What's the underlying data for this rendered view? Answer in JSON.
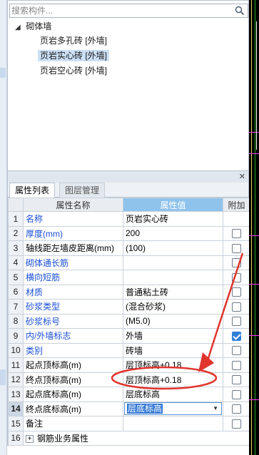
{
  "search": {
    "placeholder": "搜索构件..."
  },
  "tree": {
    "root_label": "砌体墙",
    "items": [
      {
        "label": "页岩多孔砖 [外墙]",
        "selected": false
      },
      {
        "label": "页岩实心砖 [外墙]",
        "selected": true
      },
      {
        "label": "页岩空心砖 [外墙]",
        "selected": false
      }
    ]
  },
  "tabs": [
    {
      "label": "属性列表",
      "active": true
    },
    {
      "label": "图层管理",
      "active": false
    }
  ],
  "grid": {
    "headers": {
      "name": "属性名称",
      "value": "属性值",
      "extra": "附加"
    },
    "rows": [
      {
        "num": "1",
        "name": "名称",
        "value": "页岩实心砖",
        "blue": true,
        "check": "none"
      },
      {
        "num": "2",
        "name": "厚度(mm)",
        "value": "200",
        "blue": true,
        "check": "off"
      },
      {
        "num": "3",
        "name": "轴线距左墙皮距离(mm)",
        "value": "(100)",
        "blue": false,
        "check": "off"
      },
      {
        "num": "4",
        "name": "砌体通长筋",
        "value": "",
        "blue": true,
        "check": "off"
      },
      {
        "num": "5",
        "name": "横向短筋",
        "value": "",
        "blue": true,
        "check": "off"
      },
      {
        "num": "6",
        "name": "材质",
        "value": "普通粘土砖",
        "blue": true,
        "check": "off"
      },
      {
        "num": "7",
        "name": "砂浆类型",
        "value": "(混合砂浆)",
        "blue": true,
        "check": "off"
      },
      {
        "num": "8",
        "name": "砂浆标号",
        "value": "(M5.0)",
        "blue": true,
        "check": "off"
      },
      {
        "num": "9",
        "name": "内/外墙标志",
        "value": "外墙",
        "blue": true,
        "check": "on"
      },
      {
        "num": "10",
        "name": "类别",
        "value": "砖墙",
        "blue": true,
        "check": "off"
      },
      {
        "num": "11",
        "name": "起点顶标高(m)",
        "value": "层顶标高+0.18",
        "blue": false,
        "check": "off"
      },
      {
        "num": "12",
        "name": "终点顶标高(m)",
        "value": "层顶标高+0.18",
        "blue": false,
        "check": "off"
      },
      {
        "num": "13",
        "name": "起点底标高(m)",
        "value": "层底标高",
        "blue": false,
        "check": "off"
      },
      {
        "num": "14",
        "name": "终点底标高(m)",
        "value": "层底标高",
        "blue": false,
        "check": "off",
        "editing": true
      },
      {
        "num": "15",
        "name": "备注",
        "value": "",
        "blue": false,
        "check": "off"
      },
      {
        "num": "16",
        "name": "钢筋业务属性",
        "value": "",
        "blue": false,
        "check": "none",
        "group": true
      }
    ]
  },
  "colors": {
    "annotation": "#e0342d",
    "accent": "#2f7fd6",
    "header_highlight": "#8fc3ec",
    "selection": "#cce0f6"
  }
}
